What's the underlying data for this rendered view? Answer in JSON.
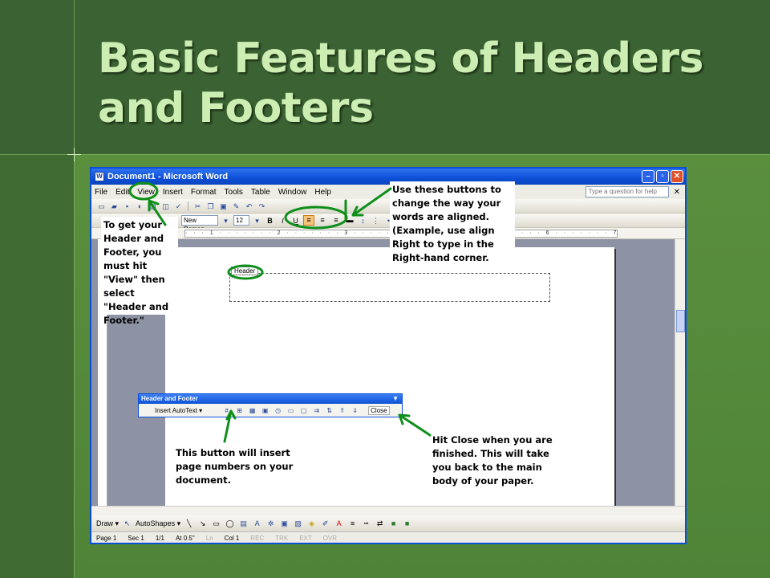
{
  "slide": {
    "title_line1": "Basic Features of Headers",
    "title_line2": "and Footers"
  },
  "word": {
    "window_title": "Document1 - Microsoft Word",
    "menu": [
      "File",
      "Edit",
      "View",
      "Insert",
      "Format",
      "Tools",
      "Table",
      "Window",
      "Help"
    ],
    "help_placeholder": "Type a question for help",
    "font_name": "New Roman",
    "font_size": "12",
    "ruler_text": "· · · 1 · · · · · · · 2 · · · · · · · 3 · · · · · · · 4 · · · · · · · 5 · · · · · · · 6 · · · · · · · 7 ·",
    "header_label": "Header",
    "drawbar": {
      "draw": "Draw ▾",
      "autoshapes": "AutoShapes ▾"
    },
    "status": {
      "page": "Page 1",
      "sec": "Sec 1",
      "pages": "1/1",
      "at": "At 0.5\"",
      "ln": "Ln",
      "col": "Col 1",
      "rec": "REC",
      "trk": "TRK",
      "ext": "EXT",
      "ovr": "OVR"
    },
    "hf_toolbar": {
      "title": "Header and Footer",
      "insert_autotext": "Insert AutoText ▾",
      "close": "Close"
    }
  },
  "callouts": {
    "view": "To get your Header and Footer, you must hit \"View\" then select \"Header and Footer.\"",
    "align": "Use these buttons to change the way your words are aligned. (Example, use align Right to type in the Right-hand corner.",
    "page_numbers": "This button will insert page numbers on your document.",
    "close": "Hit Close when you are finished. This will take you back to the main body of your paper."
  },
  "colors": {
    "annotation_green": "#0e8f1a",
    "title_text": "#cdeeb2",
    "titlebar_blue": "#0d4fd6"
  }
}
